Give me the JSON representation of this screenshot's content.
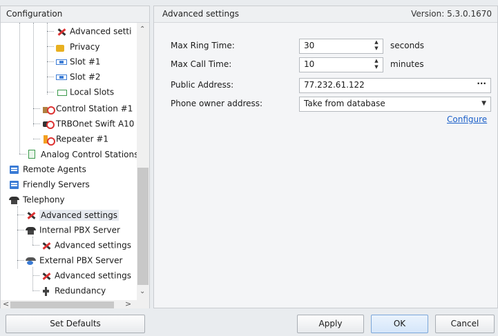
{
  "left_panel": {
    "title": "Configuration",
    "tree": [
      {
        "label": "Advanced setti",
        "icon": "tools-icon",
        "name": "tree-advanced-settings-top"
      },
      {
        "label": "Privacy",
        "icon": "lock-icon",
        "name": "tree-privacy"
      },
      {
        "label": "Slot #1",
        "icon": "slot-icon",
        "name": "tree-slot-1"
      },
      {
        "label": "Slot #2",
        "icon": "slot-icon",
        "name": "tree-slot-2"
      },
      {
        "label": "Local Slots",
        "icon": "local-slots-icon",
        "name": "tree-local-slots"
      },
      {
        "label": "Control Station #1",
        "icon": "control-station-icon",
        "name": "tree-control-station-1"
      },
      {
        "label": "TRBOnet Swift A10",
        "icon": "radio-icon",
        "name": "tree-trbonet-swift"
      },
      {
        "label": "Repeater #1",
        "icon": "repeater-icon",
        "name": "tree-repeater-1"
      },
      {
        "label": "Analog Control Stations",
        "icon": "analog-station-icon",
        "name": "tree-analog-control-stations"
      },
      {
        "label": "Remote Agents",
        "icon": "server-icon",
        "name": "tree-remote-agents"
      },
      {
        "label": "Friendly Servers",
        "icon": "server-icon",
        "name": "tree-friendly-servers"
      },
      {
        "label": "Telephony",
        "icon": "phone-icon",
        "name": "tree-telephony"
      },
      {
        "label": "Advanced settings",
        "icon": "tools-icon",
        "name": "tree-telephony-advanced-settings"
      },
      {
        "label": "Internal PBX Server",
        "icon": "phone-icon",
        "name": "tree-internal-pbx"
      },
      {
        "label": "Advanced settings",
        "icon": "tools-icon",
        "name": "tree-internal-pbx-advanced"
      },
      {
        "label": "External PBX Server",
        "icon": "external-phone-icon",
        "name": "tree-external-pbx"
      },
      {
        "label": "Advanced settings",
        "icon": "tools-icon",
        "name": "tree-external-pbx-advanced"
      },
      {
        "label": "Redundancy",
        "icon": "plug-icon",
        "name": "tree-redundancy"
      }
    ],
    "scroll_up": "⌃",
    "scroll_down": "⌄",
    "scroll_left": "<",
    "scroll_right": ">"
  },
  "right_panel": {
    "title": "Advanced settings",
    "version": "Version: 5.3.0.1670",
    "fields": {
      "max_ring_time": {
        "label": "Max Ring Time:",
        "value": "30",
        "unit": "seconds"
      },
      "max_call_time": {
        "label": "Max Call Time:",
        "value": "10",
        "unit": "minutes"
      },
      "public_address": {
        "label": "Public Address:",
        "value": "77.232.61.122",
        "button": "···"
      },
      "phone_owner": {
        "label": "Phone owner address:",
        "value": "Take from database"
      }
    },
    "configure_link": "Configure"
  },
  "buttons": {
    "set_defaults": "Set Defaults",
    "apply": "Apply",
    "ok": "OK",
    "cancel": "Cancel"
  },
  "colors": {
    "link": "#1a5fc9",
    "selection": "#e6eaf0",
    "primary_button": "#d5e6fa"
  }
}
